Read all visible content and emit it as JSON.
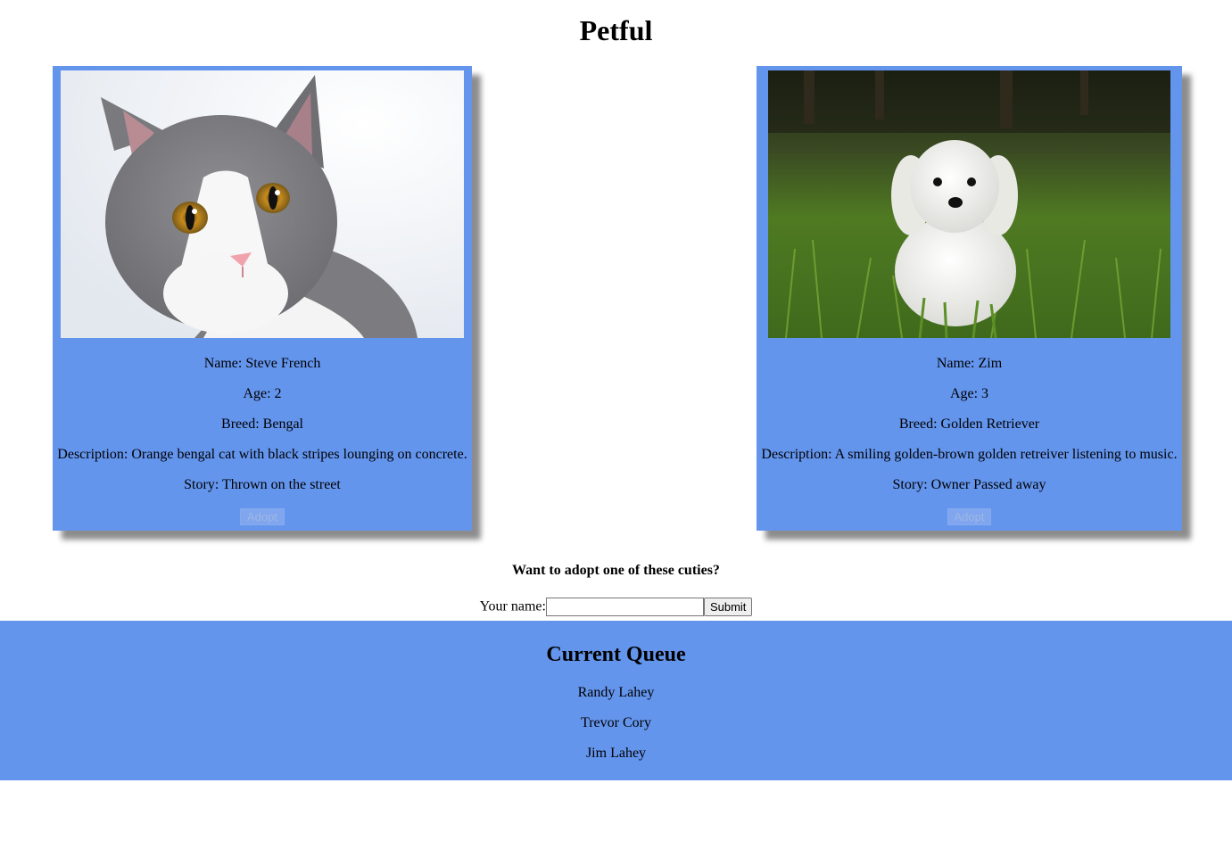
{
  "page": {
    "title": "Petful"
  },
  "pets": [
    {
      "type": "cat",
      "name_line": "Name: Steve French",
      "age_line": "Age: 2",
      "breed_line": "Breed: Bengal",
      "description_line": "Description: Orange bengal cat with black stripes lounging on concrete.",
      "story_line": "Story: Thrown on the street",
      "adopt_label": "Adopt"
    },
    {
      "type": "dog",
      "name_line": "Name: Zim",
      "age_line": "Age: 3",
      "breed_line": "Breed: Golden Retriever",
      "description_line": "Description: A smiling golden-brown golden retreiver listening to music.",
      "story_line": "Story: Owner Passed away",
      "adopt_label": "Adopt"
    }
  ],
  "adoption_form": {
    "prompt": "Want to adopt one of these cuties?",
    "name_label": "Your name:",
    "name_value": "",
    "submit_label": "Submit"
  },
  "queue": {
    "title": "Current Queue",
    "people": [
      "Randy Lahey",
      "Trevor Cory",
      "Jim Lahey"
    ]
  },
  "colors": {
    "accent": "#6495ed"
  }
}
